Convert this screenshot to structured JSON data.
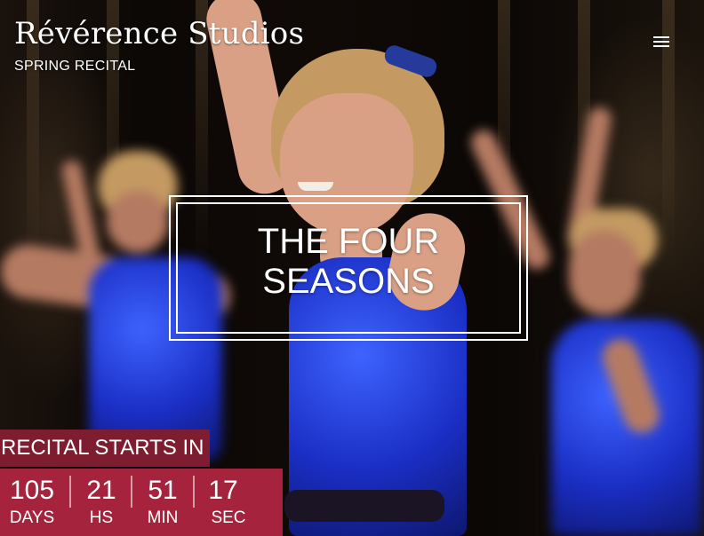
{
  "header": {
    "brand": "Révérence Studios",
    "subtitle": "SPRING RECITAL",
    "menu_icon": "hamburger-menu-icon"
  },
  "hero": {
    "title_line1": "THE FOUR",
    "title_line2": "SEASONS",
    "image": "dancers-on-stage-photo"
  },
  "countdown": {
    "label": "RECITAL STARTS IN",
    "units": [
      {
        "value": "105",
        "label": "DAYS"
      },
      {
        "value": "21",
        "label": "HS"
      },
      {
        "value": "51",
        "label": "MIN"
      },
      {
        "value": "17",
        "label": "SEC"
      }
    ]
  },
  "colors": {
    "label_bg": "#7e1d2f",
    "countdown_bg": "#a5233d",
    "text": "#ffffff"
  }
}
